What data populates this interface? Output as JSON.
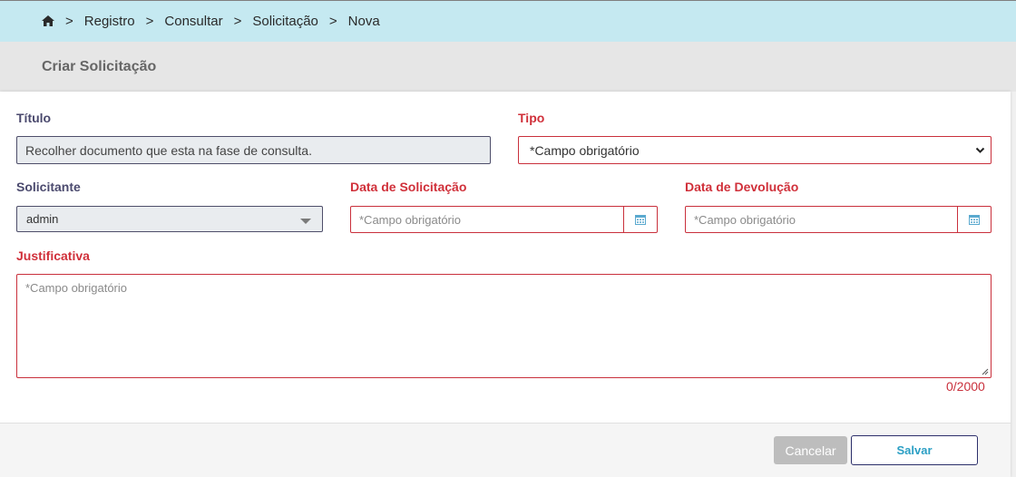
{
  "breadcrumb": {
    "items": [
      "Registro",
      "Consultar",
      "Solicitação",
      "Nova"
    ],
    "separator": ">"
  },
  "page": {
    "title": "Criar Solicitação"
  },
  "form": {
    "titulo": {
      "label": "Título",
      "value": "Recolher documento que esta na fase de consulta."
    },
    "tipo": {
      "label": "Tipo",
      "value": "*Campo obrigatório"
    },
    "solicitante": {
      "label": "Solicitante",
      "value": "admin"
    },
    "data_solicitacao": {
      "label": "Data de Solicitação",
      "placeholder": "*Campo obrigatório"
    },
    "data_devolucao": {
      "label": "Data de Devolução",
      "placeholder": "*Campo obrigatório"
    },
    "justificativa": {
      "label": "Justificativa",
      "placeholder": "*Campo obrigatório",
      "counter": "0/2000"
    }
  },
  "actions": {
    "cancel_label": "Cancelar",
    "save_label": "Salvar"
  },
  "colors": {
    "breadcrumb_bg": "#c5e9f1",
    "required": "#d0303a",
    "label": "#4b4a6e",
    "save_text": "#2b9fc4"
  },
  "icons": {
    "home": "home-icon",
    "calendar": "calendar-icon",
    "dropdown": "chevron-down-icon"
  }
}
